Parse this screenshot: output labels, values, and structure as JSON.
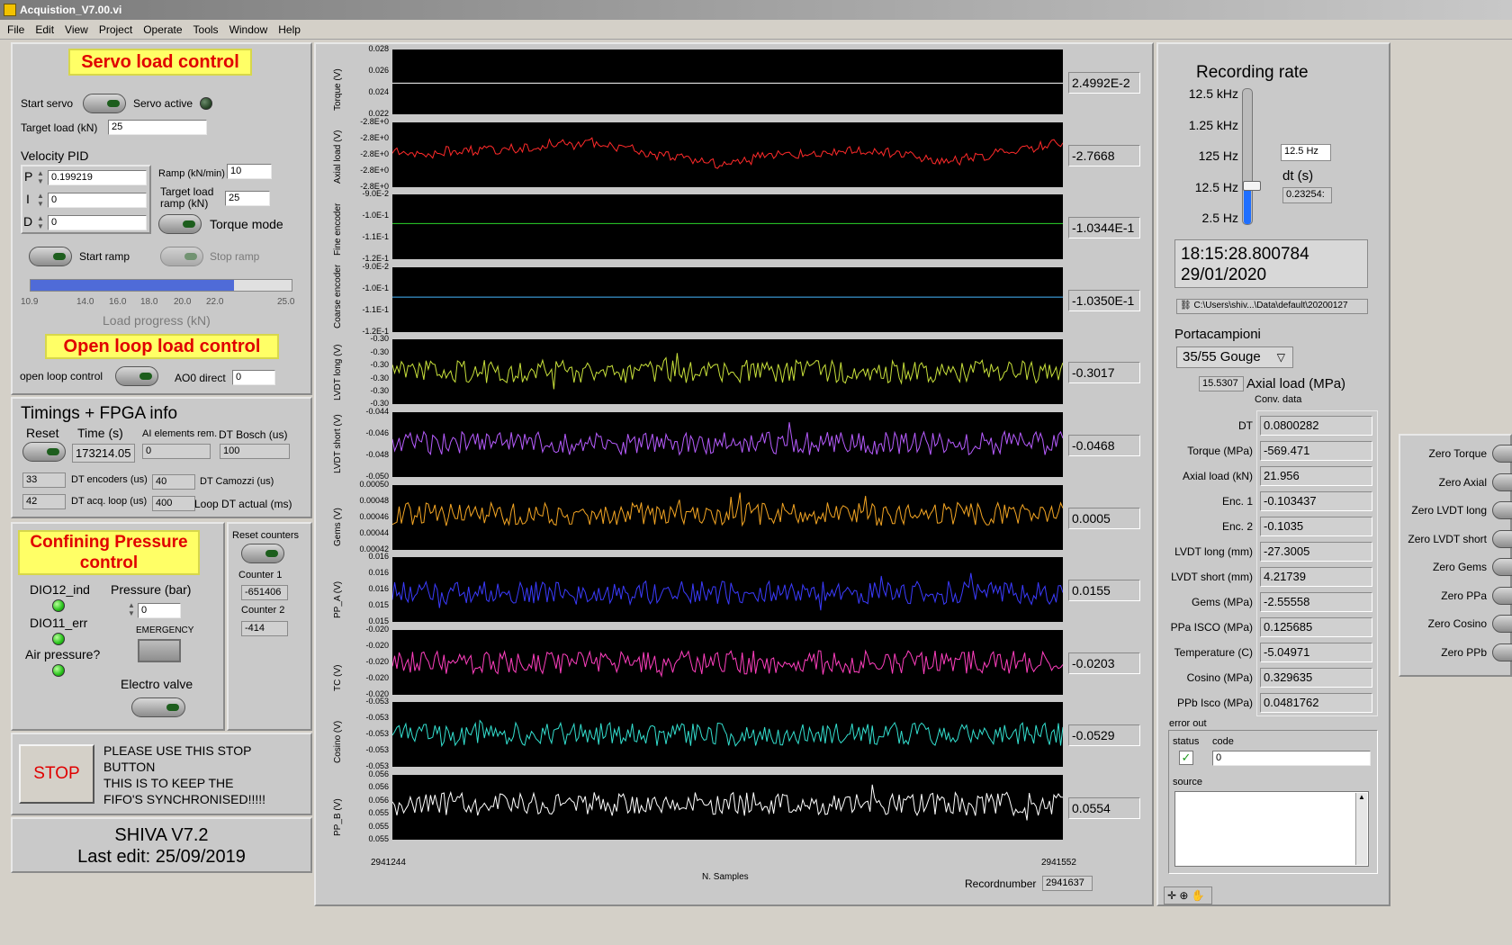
{
  "window": {
    "title": "Acquistion_V7.00.vi"
  },
  "menu": [
    "File",
    "Edit",
    "View",
    "Project",
    "Operate",
    "Tools",
    "Window",
    "Help"
  ],
  "servo": {
    "title": "Servo load control",
    "start_servo": "Start servo",
    "servo_active": "Servo active",
    "target_load_label": "Target load (kN)",
    "target_load": "25",
    "velocity_pid": "Velocity PID",
    "p_label": "P",
    "p": "0.199219",
    "i_label": "I",
    "i": "0",
    "d_label": "D",
    "d": "0",
    "ramp_label": "Ramp (kN/min)",
    "ramp": "10",
    "target_ramp_label_1": "Target load",
    "target_ramp_label_2": "ramp (kN)",
    "target_ramp": "25",
    "torque_mode": "Torque mode",
    "start_ramp": "Start ramp",
    "stop_ramp": "Stop ramp",
    "progress_ticks": [
      "10.9",
      "14.0",
      "16.0",
      "18.0",
      "20.0",
      "22.0",
      "25.0"
    ],
    "progress_label": "Load progress (kN)",
    "progress_fraction": 0.78
  },
  "openloop": {
    "title": "Open loop load control",
    "label": "open loop control",
    "ao_label": "AO0 direct",
    "ao": "0"
  },
  "timings": {
    "title": "Timings + FPGA info",
    "reset": "Reset",
    "time_label": "Time (s)",
    "time": "173214.05",
    "ai_label": "AI elements rem.",
    "ai": "0",
    "dt_bosch_label": "DT Bosch (us)",
    "dt_bosch": "100",
    "enc": "33",
    "enc_label": "DT encoders (us)",
    "camozzi": "40",
    "camozzi_label": "DT Camozzi (us)",
    "acq": "42",
    "acq_label": "DT acq. loop (us)",
    "loop": "400",
    "loop_label": "Loop DT actual (ms)"
  },
  "confining": {
    "title_1": "Confining Pressure",
    "title_2": "control",
    "dio12": "DIO12_ind",
    "dio11": "DIO11_err",
    "air": "Air pressure?",
    "pressure_label": "Pressure (bar)",
    "pressure": "0",
    "emergency": "EMERGENCY",
    "electro": "Electro valve"
  },
  "counters": {
    "reset": "Reset counters",
    "c1_label": "Counter 1",
    "c1": "-651406",
    "c2_label": "Counter 2",
    "c2": "-414"
  },
  "stop": {
    "button": "STOP",
    "msg_1": "PLEASE USE THIS STOP",
    "msg_2": "BUTTON",
    "msg_3": "THIS IS TO KEEP THE",
    "msg_4": "FIFO'S SYNCHRONISED!!!!!"
  },
  "footer": {
    "line1": "SHIVA V7.2",
    "line2": "Last edit: 25/09/2019"
  },
  "plots": [
    {
      "label": "Torque (V)",
      "ticks": [
        "0.028",
        "0.026",
        "0.024",
        "0.022"
      ],
      "value": "2.4992E-2",
      "color": "#ffffff",
      "kind": "flat",
      "level": 0.52
    },
    {
      "label": "Axial load (V)",
      "ticks": [
        "-2.8E+0",
        "-2.8E+0",
        "-2.8E+0",
        "-2.8E+0",
        "-2.8E+0"
      ],
      "value": "-2.7668",
      "color": "#ff2a2a",
      "kind": "wander",
      "level": 0.45
    },
    {
      "label": "Fine encoder",
      "ticks": [
        "-9.0E-2",
        "-1.0E-1",
        "-1.1E-1",
        "-1.2E-1"
      ],
      "value": "-1.0344E-1",
      "color": "#2bd62b",
      "kind": "flat",
      "level": 0.45
    },
    {
      "label": "Coarse encoder",
      "ticks": [
        "-9.0E-2",
        "-1.0E-1",
        "-1.1E-1",
        "-1.2E-1"
      ],
      "value": "-1.0350E-1",
      "color": "#47b8ff",
      "kind": "flat",
      "level": 0.46
    },
    {
      "label": "LVDT long (V)",
      "ticks": [
        "-0.30",
        "-0.30",
        "-0.30",
        "-0.30",
        "-0.30",
        "-0.30"
      ],
      "value": "-0.3017",
      "color": "#c8e03a",
      "kind": "noise",
      "level": 0.5
    },
    {
      "label": "LVDT short (V)",
      "ticks": [
        "-0.044",
        "-0.046",
        "-0.048",
        "-0.050"
      ],
      "value": "-0.0468",
      "color": "#b75cff",
      "kind": "noise",
      "level": 0.48
    },
    {
      "label": "Gems (V)",
      "ticks": [
        "0.00050",
        "0.00048",
        "0.00046",
        "0.00044",
        "0.00042"
      ],
      "value": "0.0005",
      "color": "#f5a623",
      "kind": "noise",
      "level": 0.45
    },
    {
      "label": "PP_A (V)",
      "ticks": [
        "0.016",
        "0.016",
        "0.016",
        "0.015",
        "0.015"
      ],
      "value": "0.0155",
      "color": "#3b3bff",
      "kind": "noise",
      "level": 0.55
    },
    {
      "label": "TC (V)",
      "ticks": [
        "-0.020",
        "-0.020",
        "-0.020",
        "-0.020",
        "-0.020"
      ],
      "value": "-0.0203",
      "color": "#ff3fbf",
      "kind": "noise",
      "level": 0.5
    },
    {
      "label": "Cosino (V)",
      "ticks": [
        "-0.053",
        "-0.053",
        "-0.053",
        "-0.053",
        "-0.053"
      ],
      "value": "-0.0529",
      "color": "#33e0d0",
      "kind": "noise",
      "level": 0.5
    },
    {
      "label": "PP_B (V)",
      "ticks": [
        "0.056",
        "0.056",
        "0.056",
        "0.055",
        "0.055",
        "0.055"
      ],
      "value": "0.0554",
      "color": "#ffffff",
      "kind": "noise",
      "level": 0.45
    }
  ],
  "xaxis": {
    "start": "2941244",
    "end": "2941552",
    "label": "N. Samples"
  },
  "recordnumber": {
    "label": "Recordnumber",
    "value": "2941637"
  },
  "recording": {
    "title": "Recording rate",
    "levels": [
      "12.5 kHz",
      "1.25 kHz",
      "125 Hz",
      "12.5 Hz",
      "2.5 Hz"
    ],
    "selected": "12.5 Hz",
    "slider_fraction": 0.28,
    "dt_label": "dt (s)",
    "dt": "0.23254:"
  },
  "timestamp": {
    "time": "18:15:28.800784",
    "date": "29/01/2020"
  },
  "path": "C:\\Users\\shiv...\\Data\\default\\20200127",
  "portacampioni": {
    "label": "Portacampioni",
    "value": "35/55 Gouge"
  },
  "axial_mpa": {
    "value": "15.5307",
    "label": "Axial load (MPa)"
  },
  "conv": {
    "title": "Conv. data",
    "rows": [
      {
        "label": "DT",
        "value": "0.0800282"
      },
      {
        "label": "Torque (MPa)",
        "value": "-569.471"
      },
      {
        "label": "Axial load (kN)",
        "value": "21.956"
      },
      {
        "label": "Enc. 1",
        "value": "-0.103437"
      },
      {
        "label": "Enc. 2",
        "value": "-0.1035"
      },
      {
        "label": "LVDT long (mm)",
        "value": "-27.3005"
      },
      {
        "label": "LVDT short (mm)",
        "value": "4.21739"
      },
      {
        "label": "Gems (MPa)",
        "value": "-2.55558"
      },
      {
        "label": "PPa ISCO (MPa)",
        "value": "0.125685"
      },
      {
        "label": "Temperature (C)",
        "value": "-5.04971"
      },
      {
        "label": "Cosino (MPa)",
        "value": "0.329635"
      },
      {
        "label": "PPb Isco (MPa)",
        "value": "0.0481762"
      }
    ]
  },
  "error": {
    "title": "error out",
    "status": "status",
    "code_label": "code",
    "code": "0",
    "source": "source"
  },
  "zero": [
    "Zero Torque",
    "Zero Axial",
    "Zero LVDT long",
    "Zero LVDT short",
    "Zero Gems",
    "Zero PPa",
    "Zero Cosino",
    "Zero PPb"
  ]
}
